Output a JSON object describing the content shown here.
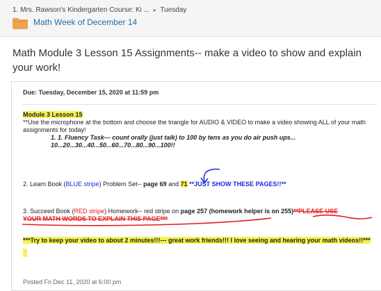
{
  "breadcrumb": {
    "course": "1. Mrs. Rawson's Kindergarten Course: Ki ...",
    "sep": "▸",
    "day": "Tuesday"
  },
  "folder": {
    "title": "Math Week of December 14",
    "icon": "folder-icon",
    "color": "#f0a350"
  },
  "page_title": "Math Module 3 Lesson 15 Assignments-- make a video to show and explain your work!",
  "due": {
    "label": "Due:",
    "value": "Tuesday, December 15, 2020 at 11:59 pm"
  },
  "content": {
    "module": "Module 3  Lesson 15",
    "instructions": "**Use the microphone at the bottom and choose the triangle for AUDIO & VIDEO to make a video showing ALL of your math assignments for today!",
    "fluency_1": "1.  1.  Fluency Task---  count orally (just talk)  to 100 by tens as you do air push ups...",
    "fluency_2": "10...20...30...40...50...60...70...80...90...100!!",
    "learn_prefix": "2.  Learn Book (",
    "learn_stripe": "BLUE stripe",
    "learn_mid": ") Problem Set-- ",
    "learn_pages": "page 69",
    "learn_and": " and ",
    "learn_page2": "71",
    "learn_note": " **JUST SHOW THESE PAGES!!**",
    "succeed_prefix": "3. Succeed Book (",
    "succeed_stripe": "RED stripe",
    "succeed_mid": ") Homework-- red stripe on ",
    "succeed_page": "page 257",
    "succeed_helper": "  (homework helper is on 255)",
    "succeed_note_a": "**PLEASE USE",
    "succeed_note_b": "YOUR MATH WORDS TO EXPLAIN THIS PAGE***",
    "closing": "***Try to keep your video to about 2 minutes!!!--- great work friends!!!  I love seeing and hearing your math videos!!***"
  },
  "posted": "Posted Fri Dec 11, 2020 at 6:00 pm",
  "colors": {
    "highlight": "#f5f250",
    "red": "#e31b1b",
    "blue": "#1a2ad9",
    "link": "#1f6fa8"
  }
}
